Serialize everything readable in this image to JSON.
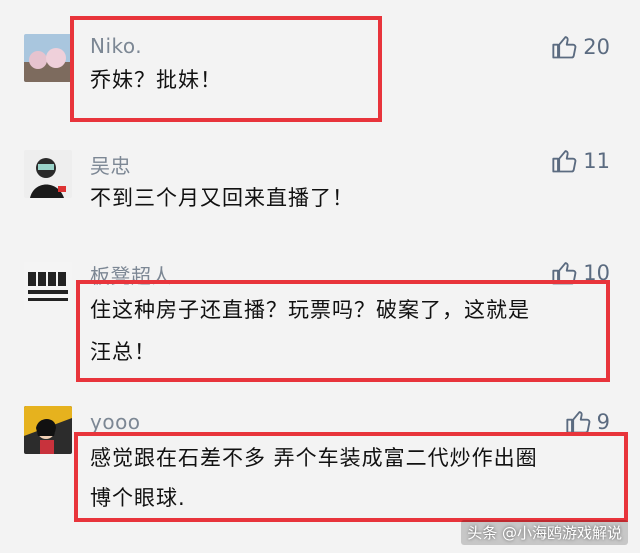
{
  "comments": [
    {
      "user": "Niko.",
      "likes": "20",
      "text": [
        "乔妹？批妹！"
      ]
    },
    {
      "user": "吴忠",
      "likes": "11",
      "text": [
        "不到三个月又回来直播了！"
      ]
    },
    {
      "user": "板凳超人",
      "likes": "10",
      "text": [
        "住这种房子还直播？玩票吗？破案了，这就是",
        "汪总！"
      ]
    },
    {
      "user": "yooo",
      "likes": "9",
      "text": [
        "感觉跟在石差不多 弄个车装成富二代炒作出圈",
        "博个眼球."
      ]
    }
  ],
  "watermark": "头条 @小海鸥游戏解说",
  "colors": {
    "highlight_box": "#e8343b",
    "like_icon": "#5b6b80"
  }
}
